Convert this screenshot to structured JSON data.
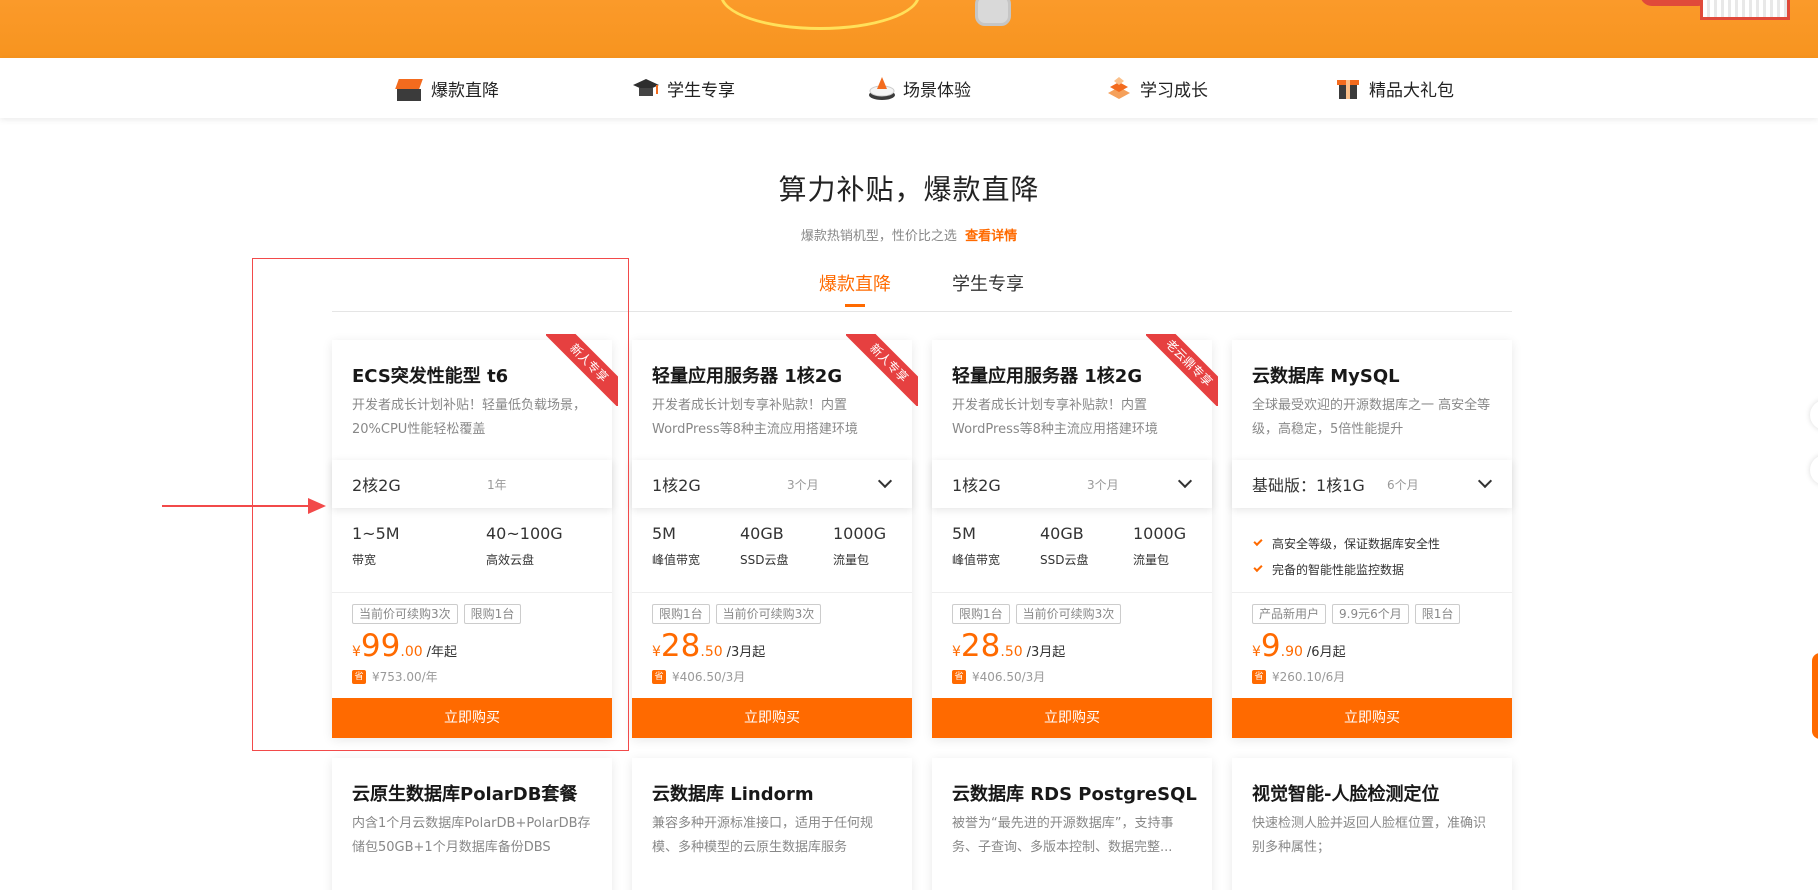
{
  "nav": [
    {
      "label": "爆款直降",
      "icon": "hot-box-icon"
    },
    {
      "label": "学生专享",
      "icon": "graduation-cap-icon"
    },
    {
      "label": "场景体验",
      "icon": "scene-podium-icon"
    },
    {
      "label": "学习成长",
      "icon": "growth-stack-icon"
    },
    {
      "label": "精品大礼包",
      "icon": "gift-box-icon"
    }
  ],
  "section": {
    "title": "算力补贴，爆款直降",
    "subtitle": "爆款热销机型，性价比之选",
    "link": "查看详情"
  },
  "tabs": [
    {
      "label": "爆款直降",
      "active": true
    },
    {
      "label": "学生专享",
      "active": false
    }
  ],
  "cards": [
    {
      "title": "ECS突发性能型 t6",
      "ribbon": "新人专享",
      "desc": "开发者成长计划补贴！轻量低负载场景，20%CPU性能轻松覆盖",
      "spec": "2核2G",
      "period": "1年",
      "stats": [
        {
          "value": "1~5M",
          "label": "带宽"
        },
        {
          "value": "40~100G",
          "label": "高效云盘"
        }
      ],
      "tags": [
        "当前价可续购3次",
        "限购1台"
      ],
      "price": {
        "currency": "¥",
        "int": "99",
        "dec": ".00",
        "unit": "/年起"
      },
      "save_badge": "省",
      "orig": "¥753.00/年",
      "buy": "立即购买"
    },
    {
      "title": "轻量应用服务器 1核2G",
      "ribbon": "新人专享",
      "desc": "开发者成长计划专享补贴款！内置WordPress等8种主流应用搭建环境",
      "spec": "1核2G",
      "period": "3个月",
      "stats": [
        {
          "value": "5M",
          "label": "峰值带宽"
        },
        {
          "value": "40GB",
          "label": "SSD云盘"
        },
        {
          "value": "1000G",
          "label": "流量包"
        }
      ],
      "tags": [
        "限购1台",
        "当前价可续购3次"
      ],
      "price": {
        "currency": "¥",
        "int": "28",
        "dec": ".50",
        "unit": "/3月起"
      },
      "save_badge": "省",
      "orig": "¥406.50/3月",
      "buy": "立即购买"
    },
    {
      "title": "轻量应用服务器 1核2G",
      "ribbon": "老云鼎专享",
      "desc": "开发者成长计划专享补贴款！内置WordPress等8种主流应用搭建环境",
      "spec": "1核2G",
      "period": "3个月",
      "stats": [
        {
          "value": "5M",
          "label": "峰值带宽"
        },
        {
          "value": "40GB",
          "label": "SSD云盘"
        },
        {
          "value": "1000G",
          "label": "流量包"
        }
      ],
      "tags": [
        "限购1台",
        "当前价可续购3次"
      ],
      "price": {
        "currency": "¥",
        "int": "28",
        "dec": ".50",
        "unit": "/3月起"
      },
      "save_badge": "省",
      "orig": "¥406.50/3月",
      "buy": "立即购买"
    },
    {
      "title": "云数据库 MySQL",
      "ribbon": "",
      "desc": "全球最受欢迎的开源数据库之一 高安全等级，高稳定，5倍性能提升",
      "spec": "基础版：1核1G",
      "period": "6个月",
      "features": [
        "高安全等级，保证数据库安全性",
        "完备的智能性能监控数据"
      ],
      "tags": [
        "产品新用户",
        "9.9元6个月",
        "限1台"
      ],
      "price": {
        "currency": "¥",
        "int": "9",
        "dec": ".90",
        "unit": "/6月起"
      },
      "save_badge": "省",
      "orig": "¥260.10/6月",
      "buy": "立即购买"
    }
  ],
  "cards_row2": [
    {
      "title": "云原生数据库PolarDB套餐",
      "desc": "内含1个月云数据库PolarDB+PolarDB存储包50GB+1个月数据库备份DBS"
    },
    {
      "title": "云数据库 Lindorm",
      "desc": "兼容多种开源标准接口，适用于任何规模、多种模型的云原生数据库服务"
    },
    {
      "title": "云数据库 RDS PostgreSQL",
      "desc": "被誉为“最先进的开源数据库”，支持事务、子查询、多版本控制、数据完整..."
    },
    {
      "title": "视觉智能-人脸检测定位",
      "desc": "快速检测人脸并返回人脸框位置，准确识别多种属性；"
    }
  ],
  "colors": {
    "accent": "#ff6a00",
    "ribbon": "#e64040",
    "highlight": "#f24a4a"
  }
}
